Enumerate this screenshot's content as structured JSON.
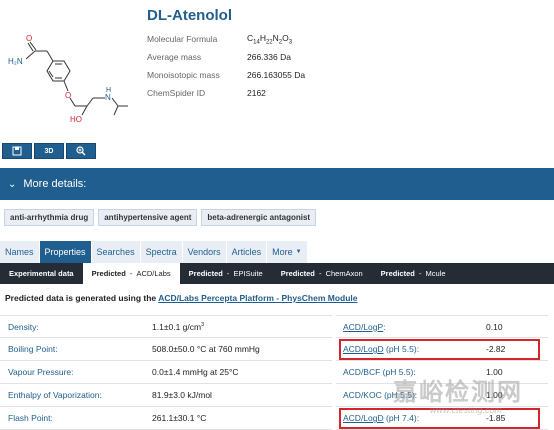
{
  "compound": {
    "title": "DL-Atenolol",
    "properties": [
      {
        "label": "Molecular Formula",
        "value_parts": [
          [
            "C",
            ""
          ],
          [
            "14",
            "sub"
          ],
          [
            "H",
            ""
          ],
          [
            "22",
            "sub"
          ],
          [
            "N",
            ""
          ],
          [
            "2",
            "sub"
          ],
          [
            "O",
            ""
          ],
          [
            "3",
            "sub"
          ]
        ]
      },
      {
        "label": "Average mass",
        "value": "266.336 Da"
      },
      {
        "label": "Monoisotopic mass",
        "value": "266.163055 Da"
      },
      {
        "label": "ChemSpider ID",
        "value": "2162"
      }
    ],
    "structure_labels": {
      "o1": "O",
      "h2n": "H₂N",
      "o2": "O",
      "oh": "HO",
      "nh": "N",
      "h": "H"
    }
  },
  "tools": {
    "save_icon": "save-icon",
    "view3d": "3D",
    "zoom_icon": "zoom-icon"
  },
  "details_bar": {
    "label": "More details:",
    "icon": "chevron-down-icon"
  },
  "tags": [
    "anti-arrhythmia drug",
    "antihypertensive agent",
    "beta-adrenergic antagonist"
  ],
  "tabs": [
    {
      "label": "Names",
      "active": false
    },
    {
      "label": "Properties",
      "active": true
    },
    {
      "label": "Searches",
      "active": false
    },
    {
      "label": "Spectra",
      "active": false
    },
    {
      "label": "Vendors",
      "active": false
    },
    {
      "label": "Articles",
      "active": false
    },
    {
      "label": "More",
      "active": false
    }
  ],
  "subtabs": [
    {
      "label": "Experimental data",
      "source": "",
      "active": false
    },
    {
      "label": "Predicted",
      "source": "ACD/Labs",
      "active": true
    },
    {
      "label": "Predicted",
      "source": "EPISuite",
      "active": false
    },
    {
      "label": "Predicted",
      "source": "ChemAxon",
      "active": false
    },
    {
      "label": "Predicted",
      "source": "Mcule",
      "active": false
    }
  ],
  "predicted_heading": {
    "prefix": "Predicted data is generated using the ",
    "link": "ACD/Labs Percepta Platform - PhysChem Module"
  },
  "left_table": [
    {
      "name": "Density:",
      "value": "1.1±0.1 g/cm",
      "sup": "3"
    },
    {
      "name": "Boiling Point:",
      "value": "508.0±50.0 °C at 760 mmHg",
      "sup": ""
    },
    {
      "name": "Vapour Pressure:",
      "value": "0.0±1.4 mmHg at 25°C",
      "sup": ""
    },
    {
      "name": "Enthalpy of Vaporization:",
      "value": "81.9±3.0 kJ/mol",
      "sup": ""
    },
    {
      "name": "Flash Point:",
      "value": "261.1±30.1 °C",
      "sup": ""
    }
  ],
  "right_table": [
    {
      "name": "ACD/LogP",
      "suffix": ":",
      "underline": true,
      "value": "0.10",
      "highlight": false
    },
    {
      "name": "ACD/LogD",
      "suffix": " (pH 5.5):",
      "underline": true,
      "value": "-2.82",
      "highlight": true
    },
    {
      "name": "ACD/BCF",
      "suffix": " (pH 5.5):",
      "underline": false,
      "value": "1.00",
      "highlight": false
    },
    {
      "name": "ACD/KOC",
      "suffix": " (pH 5.5):",
      "underline": false,
      "value": "1.00",
      "highlight": false
    },
    {
      "name": "ACD/LogD",
      "suffix": " (pH 7.4):",
      "underline": true,
      "value": "-1.85",
      "highlight": true
    }
  ],
  "watermark": {
    "text": "嘉峪检测网",
    "url": "www.ctesting.com"
  },
  "colors": {
    "primary": "#1f5e8f",
    "dark_bar": "#252c35",
    "highlight": "#d4252a",
    "tag_bg": "#e8eef4"
  }
}
